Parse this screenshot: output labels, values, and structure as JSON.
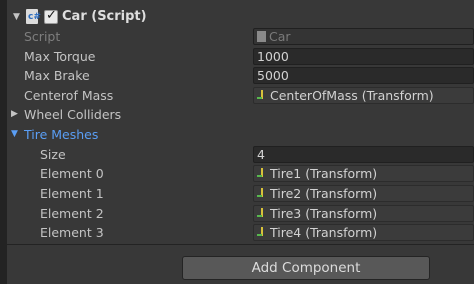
{
  "component": {
    "title": "Car (Script)",
    "enabled": true
  },
  "fields": {
    "script": {
      "label": "Script",
      "value": "Car"
    },
    "max_torque": {
      "label": "Max Torque",
      "value": "1000"
    },
    "max_brake": {
      "label": "Max Brake",
      "value": "5000"
    },
    "center_of_mass": {
      "label": "Centerof Mass",
      "value": "CenterOfMass (Transform)"
    },
    "wheel_colliders": {
      "label": "Wheel Colliders"
    },
    "tire_meshes": {
      "label": "Tire Meshes",
      "size_label": "Size",
      "size_value": "4",
      "elements": [
        {
          "label": "Element 0",
          "value": "Tire1 (Transform)"
        },
        {
          "label": "Element 1",
          "value": "Tire2 (Transform)"
        },
        {
          "label": "Element 2",
          "value": "Tire3 (Transform)"
        },
        {
          "label": "Element 3",
          "value": "Tire4 (Transform)"
        }
      ]
    }
  },
  "buttons": {
    "add_component": "Add Component"
  },
  "colors": {
    "highlight": "#5a9ef5",
    "panel": "#383838"
  }
}
